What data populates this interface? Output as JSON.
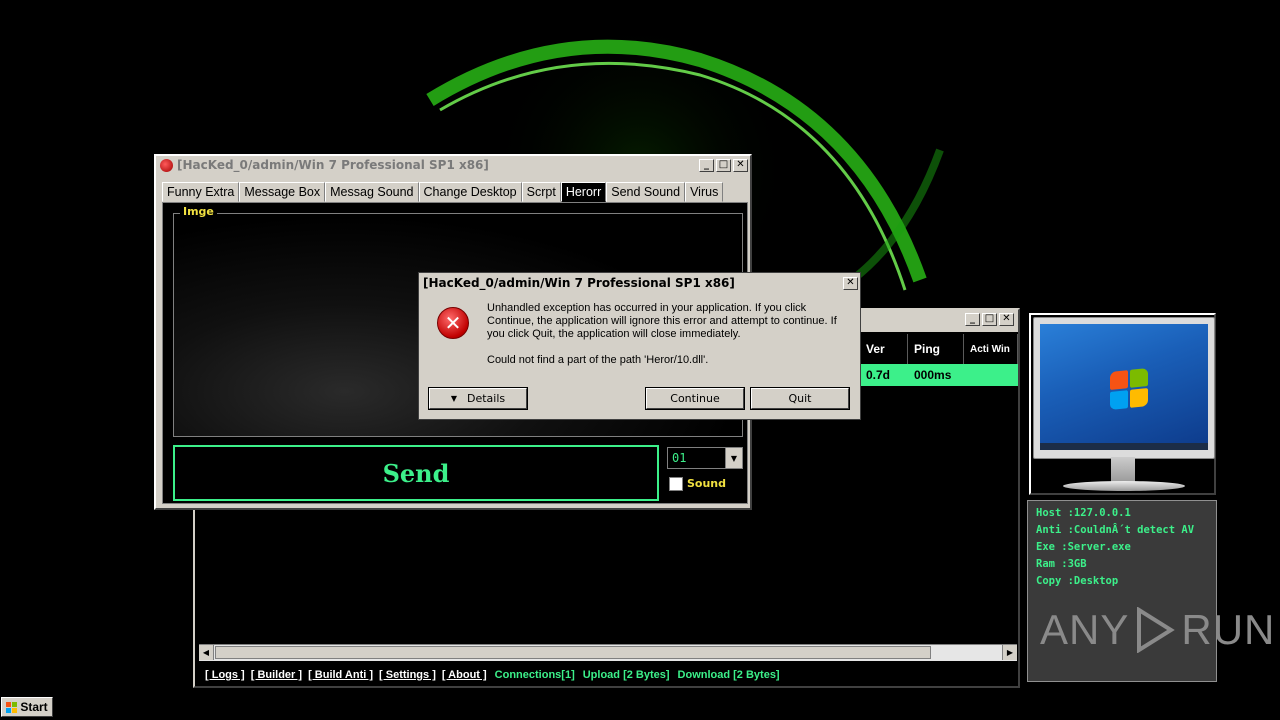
{
  "colors": {
    "accent_green": "#3cf08a",
    "label_yellow": "#f0e040",
    "window_bg": "#d4d0c8"
  },
  "main_window": {
    "table_headers": [
      "Ver",
      "Ping",
      "Acti Win"
    ],
    "row": {
      "ver": "0.7d",
      "ping": "000ms"
    },
    "status_links": [
      "[ Logs ]",
      "[ Builder ]",
      "[ Build Anti ]",
      "[ Settings ]",
      "[ About ]"
    ],
    "connections": "Connections[1]",
    "upload": "Upload [2 Bytes]",
    "download": "Download [2 Bytes]"
  },
  "fun_window": {
    "title": "[HacKed_0/admin/Win 7 Professional SP1 x86]",
    "tabs": [
      "Funny Extra",
      "Message Box",
      "Messag Sound",
      "Change Desktop",
      "Scrpt",
      "Herorr",
      "Send Sound",
      "Virus"
    ],
    "active_tab": "Herorr",
    "group_label": "Imge",
    "send_label": "Send",
    "combo_value": "01",
    "sound_label": "Sound"
  },
  "error_dialog": {
    "title": "[HacKed_0/admin/Win 7 Professional SP1 x86]",
    "message": "Unhandled exception has occurred in your application. If you click Continue, the application will ignore this error and attempt to continue. If you click Quit, the application will close immediately.",
    "detail": "Could not find a part of the path 'Heror/10.dll'.",
    "details_button": "Details",
    "continue_button": "Continue",
    "quit_button": "Quit",
    "icon": "error-icon"
  },
  "info_panel": {
    "host": "Host :127.0.0.1",
    "anti": "Anti :CouldnÂ´t detect AV",
    "exe": "Exe  :Server.exe",
    "ram": "Ram  :3GB",
    "copy": "Copy :Desktop"
  },
  "watermark": {
    "left": "ANY",
    "right": "RUN"
  },
  "taskbar": {
    "start_label": "Start"
  }
}
